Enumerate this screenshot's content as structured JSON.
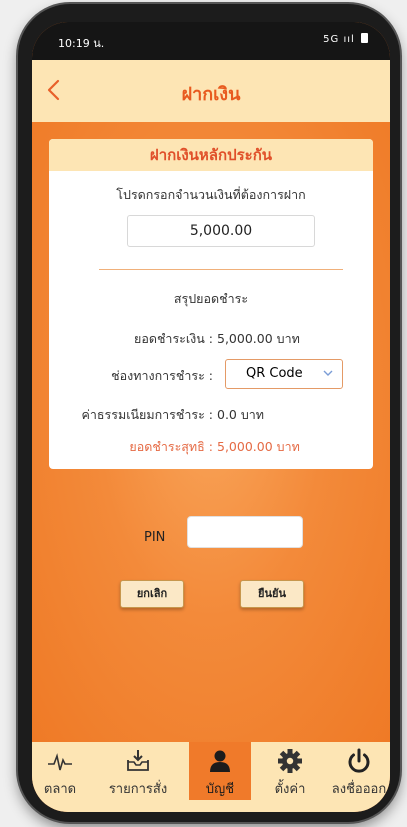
{
  "status_bar": {
    "time": "10:19 น.",
    "signal": "5G",
    "signal_bars": "ııl"
  },
  "header": {
    "back_icon": "chevron-left-icon",
    "title": "ฝากเงิน"
  },
  "card": {
    "heading": "ฝากเงินหลักประกัน",
    "prompt": "โปรดกรอกจำนวนเงินที่ต้องการฝาก",
    "amount_value": "5,000.00",
    "summary_title": "สรุปยอดชำระ",
    "payment_amount_label": "ยอดชำระเงิน :",
    "payment_amount_value": "5,000.00 บาท",
    "channel_label": "ช่องทางการชำระ :",
    "channel_selected": "QR Code",
    "fee_label": "ค่าธรรมเนียมการชำระ :",
    "fee_value": "0.0 บาท",
    "net_label": "ยอดชำระสุทธิ :",
    "net_value": "5,000.00 บาท"
  },
  "pin": {
    "label": "PIN",
    "value": ""
  },
  "buttons": {
    "cancel": "ยกเลิก",
    "confirm": "ยืนยัน"
  },
  "tabbar": {
    "items": [
      {
        "label": "ตลาด",
        "icon": "pulse-chart-icon"
      },
      {
        "label": "รายการสั่ง",
        "icon": "inbox-download-icon"
      },
      {
        "label": "บัญชี",
        "icon": "user-account-icon",
        "active": true
      },
      {
        "label": "ตั้งค่า",
        "icon": "gear-icon"
      },
      {
        "label": "ลงชื่อออก",
        "icon": "power-icon"
      }
    ]
  },
  "colors": {
    "accent": "#F07A2A",
    "header_bg": "#FDE5B4",
    "title_orange": "#E85A1F",
    "net_text": "#E56A44"
  }
}
